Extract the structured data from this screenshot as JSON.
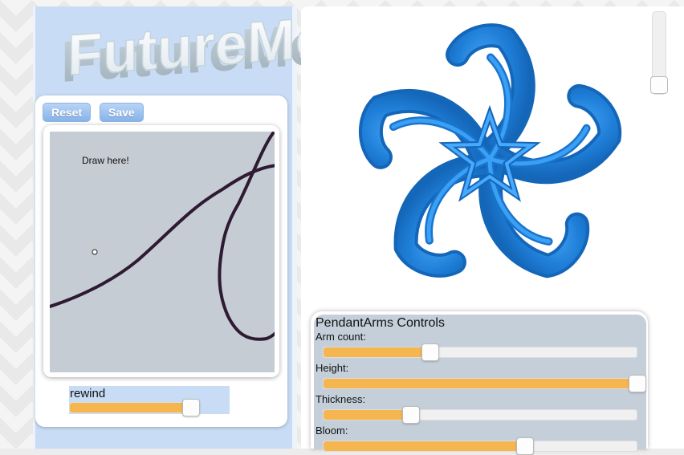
{
  "app": {
    "logo_text": "FutureMe"
  },
  "left": {
    "buttons": {
      "reset": "Reset",
      "save": "Save"
    },
    "canvas": {
      "hint": "Draw here!"
    },
    "rewind": {
      "label": "rewind",
      "value": 0.76
    }
  },
  "controls": {
    "title": "PendantArms Controls",
    "sliders": [
      {
        "label": "Arm count:",
        "value": 0.34
      },
      {
        "label": "Height:",
        "value": 1.0
      },
      {
        "label": "Thickness:",
        "value": 0.28
      },
      {
        "label": "Bloom:",
        "value": 0.64
      }
    ]
  },
  "colors": {
    "accent_fill": "#f5b54f",
    "panel_blue": "#c8dcf5",
    "model_blue": "#2a8be0",
    "stroke": "#2e1a33"
  }
}
